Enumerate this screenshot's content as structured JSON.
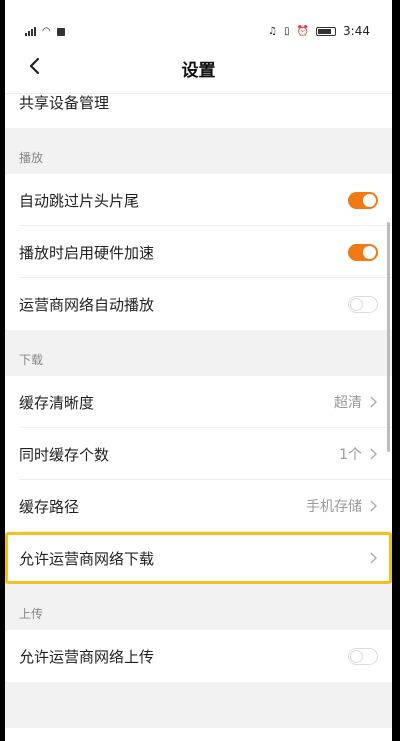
{
  "status": {
    "time": "3:44"
  },
  "header": {
    "title": "设置"
  },
  "top_partial": {
    "label": "共享设备管理"
  },
  "sections": [
    {
      "heading": "播放",
      "items": [
        {
          "label": "自动跳过片头片尾",
          "toggle": true
        },
        {
          "label": "播放时启用硬件加速",
          "toggle": true
        },
        {
          "label": "运营商网络自动播放",
          "toggle": false
        }
      ]
    },
    {
      "heading": "下载",
      "items": [
        {
          "label": "缓存清晰度",
          "value": "超清"
        },
        {
          "label": "同时缓存个数",
          "value": "1个"
        },
        {
          "label": "缓存路径",
          "value": "手机存储"
        },
        {
          "label": "允许运营商网络下载"
        }
      ]
    },
    {
      "heading": "上传",
      "items": [
        {
          "label": "允许运营商网络上传",
          "toggle": false
        }
      ]
    }
  ],
  "colors": {
    "toggle_on": "#f07a16",
    "highlight": "#f5c21b"
  }
}
